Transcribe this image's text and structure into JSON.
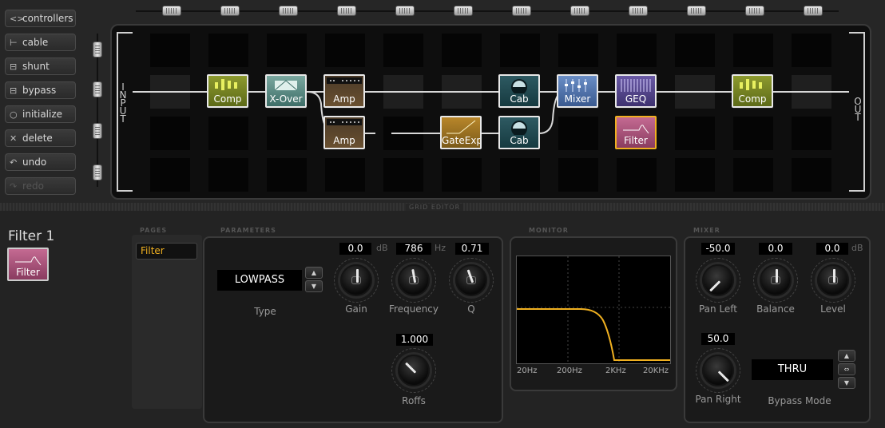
{
  "sidebar": {
    "buttons": [
      {
        "icon": "<>",
        "label": "controllers"
      },
      {
        "icon": "⊢",
        "label": "cable"
      },
      {
        "icon": "⊟",
        "label": "shunt"
      },
      {
        "icon": "⊟",
        "label": "bypass"
      },
      {
        "icon": "○",
        "label": "initialize"
      },
      {
        "icon": "✕",
        "label": "delete"
      },
      {
        "icon": "↶",
        "label": "undo"
      },
      {
        "icon": "↷",
        "label": "redo"
      }
    ]
  },
  "grid": {
    "input_label": "INPUT",
    "output_label": "OUT",
    "section_label": "GRID EDITOR",
    "blocks": {
      "comp1": "Comp",
      "xover": "X-Over",
      "amp1": "Amp",
      "cab1": "Cab",
      "mixer": "Mixer",
      "geq": "GEQ",
      "comp2": "Comp",
      "amp2": "Amp",
      "gate": "GateExp",
      "cab2": "Cab",
      "filter": "Filter"
    }
  },
  "editor": {
    "block_title": "Filter 1",
    "block_icon_label": "Filter",
    "pages_label": "PAGES",
    "pages": [
      "Filter"
    ],
    "parameters_label": "PARAMETERS",
    "type_value": "LOWPASS",
    "type_label": "Type",
    "gain": {
      "value": "0.0",
      "unit": "dB",
      "label": "Gain"
    },
    "frequency": {
      "value": "786",
      "unit": "Hz",
      "label": "Frequency"
    },
    "q": {
      "value": "0.71",
      "label": "Q"
    },
    "roffs": {
      "value": "1.000",
      "label": "Roffs"
    },
    "monitor_label": "MONITOR",
    "monitor_axis": [
      "20Hz",
      "200Hz",
      "2KHz",
      "20KHz"
    ],
    "mixer_label": "MIXER",
    "pan_left": {
      "value": "-50.0",
      "label": "Pan Left"
    },
    "balance": {
      "value": "0.0",
      "label": "Balance"
    },
    "level": {
      "value": "0.0",
      "unit": "dB",
      "label": "Level"
    },
    "pan_right": {
      "value": "50.0",
      "label": "Pan Right"
    },
    "bypass_mode": {
      "value": "THRU",
      "label": "Bypass Mode"
    }
  },
  "colors": {
    "accent": "#f0b020",
    "curve": "#f0b020"
  }
}
